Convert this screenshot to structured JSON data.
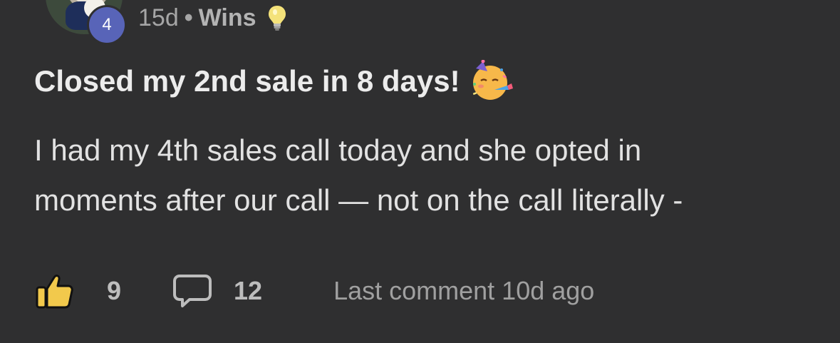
{
  "header": {
    "level": "4",
    "time_ago": "15d",
    "separator": "•",
    "category": "Wins",
    "category_icon": "lightbulb-icon"
  },
  "post": {
    "title": "Closed my 2nd sale in 8 days!",
    "title_emoji": "partying-face-icon",
    "body_lines": [
      "I had my 4th sales call today and she opted in",
      "moments after our call — not on the call literally -"
    ]
  },
  "footer": {
    "like_icon": "thumbs-up-icon",
    "like_count": "9",
    "comment_icon": "comment-bubble-icon",
    "comment_count": "12",
    "last_comment": "Last comment 10d ago"
  },
  "colors": {
    "background": "#2f2f30",
    "level_badge": "#5864b8",
    "like_icon": "#f2c94c",
    "emoji": "#f7b84a"
  }
}
